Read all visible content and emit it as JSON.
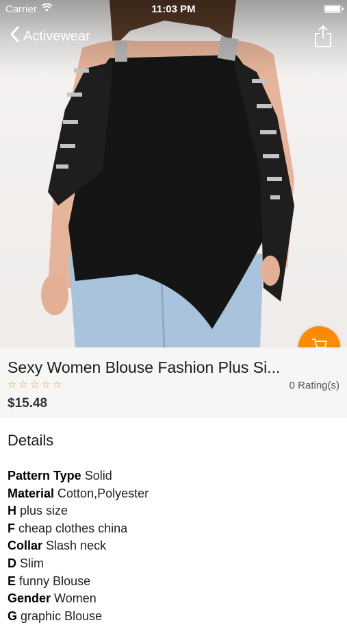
{
  "status": {
    "carrier": "Carrier",
    "time": "11:03 PM"
  },
  "nav": {
    "back_label": "Activewear"
  },
  "product": {
    "title": "Sexy Women Blouse Fashion Plus Si...",
    "rating_value": 0,
    "rating_max": 5,
    "ratings_text": "0 Rating(s)",
    "price": "$15.48"
  },
  "details": {
    "heading": "Details",
    "specs": [
      {
        "key": "Pattern Type",
        "value": "Solid"
      },
      {
        "key": "Material",
        "value": "Cotton,Polyester"
      },
      {
        "key": "H",
        "value": "plus size"
      },
      {
        "key": "F",
        "value": "cheap clothes china"
      },
      {
        "key": "Collar",
        "value": "Slash neck"
      },
      {
        "key": "D",
        "value": "Slim"
      },
      {
        "key": "E",
        "value": "funny Blouse"
      },
      {
        "key": "Gender",
        "value": "Women"
      },
      {
        "key": "G",
        "value": "graphic Blouse"
      }
    ]
  },
  "colors": {
    "accent": "#ff8a00",
    "star": "#f0a030",
    "info_bg": "#f6f6f4"
  },
  "icons": {
    "back": "chevron-left-icon",
    "share": "share-icon",
    "cart": "cart-icon",
    "wifi": "wifi-icon",
    "battery": "battery-icon"
  }
}
